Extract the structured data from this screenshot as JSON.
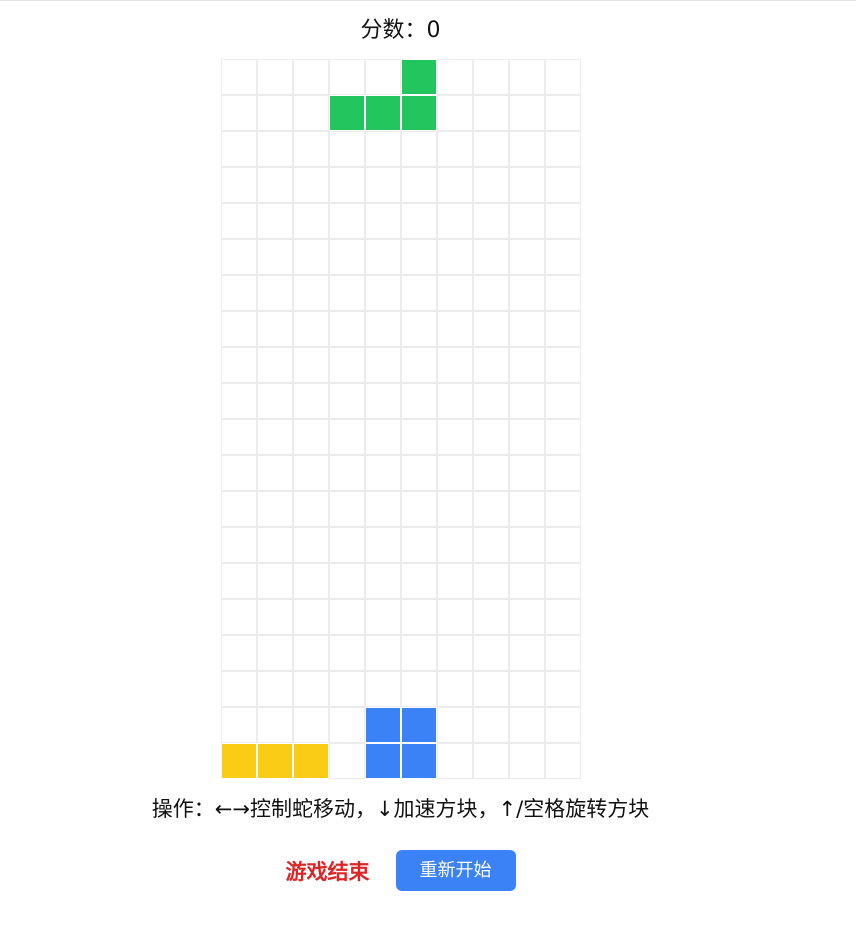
{
  "score": {
    "text": "分数：0"
  },
  "board": {
    "columns": 10,
    "rows": 20,
    "empty_color": "#ffffff",
    "grid_color": "#ececec",
    "pieces": [
      {
        "name": "falling-l-piece",
        "color": "#22c55e",
        "cells": [
          [
            0,
            5
          ],
          [
            1,
            3
          ],
          [
            1,
            4
          ],
          [
            1,
            5
          ]
        ]
      },
      {
        "name": "locked-i-piece",
        "color": "#facc15",
        "cells": [
          [
            19,
            0
          ],
          [
            19,
            1
          ],
          [
            19,
            2
          ]
        ]
      },
      {
        "name": "locked-o-piece",
        "color": "#3b82f6",
        "cells": [
          [
            18,
            4
          ],
          [
            18,
            5
          ],
          [
            19,
            4
          ],
          [
            19,
            5
          ]
        ]
      }
    ]
  },
  "instructions": {
    "text": "操作：←→控制蛇移动，↓加速方块，↑/空格旋转方块"
  },
  "status": {
    "game_over_text": "游戏结束",
    "restart_label": "重新开始"
  },
  "colors": {
    "game_over": "#dc2626",
    "button": "#3b82f6"
  }
}
